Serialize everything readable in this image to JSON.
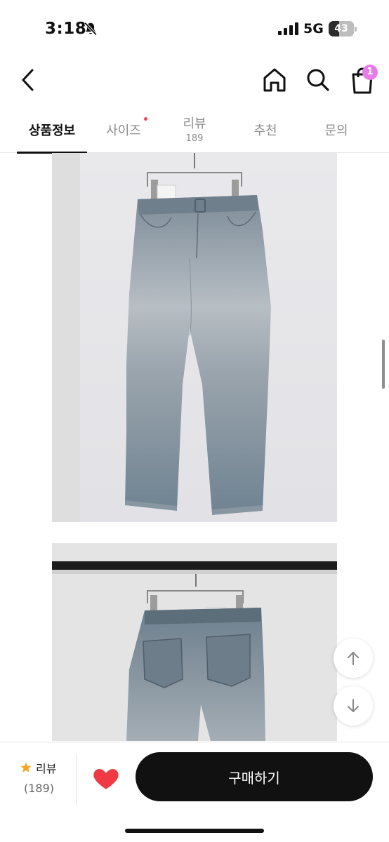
{
  "status_bar": {
    "time": "3:18",
    "network": "5G",
    "battery": "43",
    "battery_level": 0.43,
    "icons": [
      "bell-slash-icon",
      "cellular-signal-icon",
      "battery-icon"
    ]
  },
  "header": {
    "icons": [
      "chevron-left-icon",
      "home-icon",
      "search-icon",
      "shopping-bag-icon"
    ],
    "cart_count": "1"
  },
  "tabs": [
    {
      "label": "상품정보",
      "active": true
    },
    {
      "label": "사이즈",
      "new_dot": true
    },
    {
      "label": "리뷰",
      "count": "189"
    },
    {
      "label": "추천"
    },
    {
      "label": "문의"
    }
  ],
  "floating": {
    "icons": [
      "arrow-up-icon",
      "arrow-down-icon"
    ]
  },
  "bottom_bar": {
    "review_label": "리뷰",
    "review_count": "(189)",
    "buy_label": "구매하기",
    "icons": [
      "star-icon",
      "heart-icon"
    ]
  },
  "colors": {
    "accent_badge": "#e77be9",
    "heart": "#ef3a43",
    "star": "#f5a623",
    "tab_dot": "#f2435a",
    "buy_button": "#111111"
  }
}
